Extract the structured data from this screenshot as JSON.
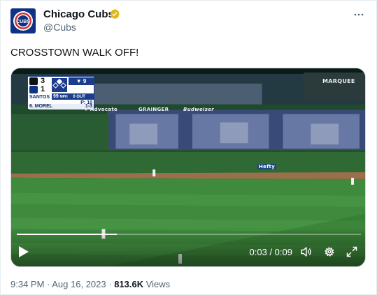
{
  "author": {
    "name": "Chicago Cubs",
    "handle": "@Cubs",
    "avatar_icon": "cubs-logo-icon",
    "verified_icon": "gold-verified-badge-icon",
    "brand_color": "#0e3386"
  },
  "more_icon": "more-options-icon",
  "tweet_text": "CROSSTOWN WALK OFF!",
  "video": {
    "scoreboard": {
      "away_score": "3",
      "home_score": "1",
      "inning": "▼ 9",
      "pitch_speed": "99",
      "pitch_unit": "MPH",
      "outs": "0 OUT",
      "pitcher": "SANTOS",
      "pitch_count": "P: 10",
      "batter": "6. MOREL",
      "batter_line": "1-3"
    },
    "signage": {
      "marquee": "MARQUEE",
      "advocate": "+ Advocate",
      "grainger": "GRAINGER",
      "budweiser": "Budweiser",
      "hefty": "Hefty"
    },
    "time_display": "0:03 / 0:09",
    "progress": 0.29,
    "icons": {
      "play": "play-icon",
      "volume": "volume-icon",
      "settings": "settings-gear-icon",
      "fullscreen": "fullscreen-icon"
    }
  },
  "meta": {
    "time": "9:34 PM",
    "separator1": " · ",
    "date": "Aug 16, 2023",
    "separator2": " · ",
    "views_count": "813.6K",
    "views_label": " Views"
  }
}
